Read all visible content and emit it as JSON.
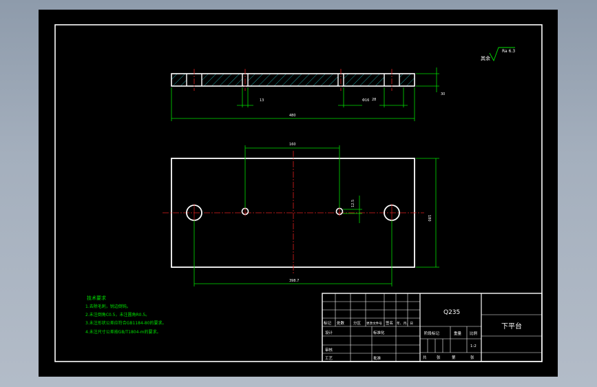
{
  "drawing": {
    "surface_symbol": "其余",
    "surface_value": "Ra 6.3",
    "dims": {
      "thickness": "30",
      "length": "480",
      "hole_small_a": "13",
      "hole_small_b": "Φ16",
      "hole_big": "28",
      "center_spacing": "160",
      "height": "180",
      "offset_v": "12.5",
      "big_spacing": "398.7"
    },
    "tech_notes": {
      "title": "技术要求",
      "lines": [
        "1.去除毛刺，锐边倒钝。",
        "2.未注倒角C0.5，未注圆角R0.5。",
        "3.未注形状公差应符合GB1184-80的要求。",
        "4.未注尺寸公差按GB/T1804-m的要求。"
      ]
    },
    "title_block": {
      "material": "Q235",
      "part_name": "下平台",
      "rev_headers": [
        "标记",
        "处数",
        "分区",
        "更改文件号",
        "签名",
        "年、月、日"
      ],
      "designer": "设计",
      "standardization": "标准化",
      "checker": "审核",
      "process": "工艺",
      "approval": "批准",
      "stage_mark": "阶段标记",
      "weight": "重量",
      "scale_label": "比例",
      "scale_value": "1:2",
      "sheet_info": [
        "共",
        "张",
        "第",
        "张"
      ]
    }
  }
}
